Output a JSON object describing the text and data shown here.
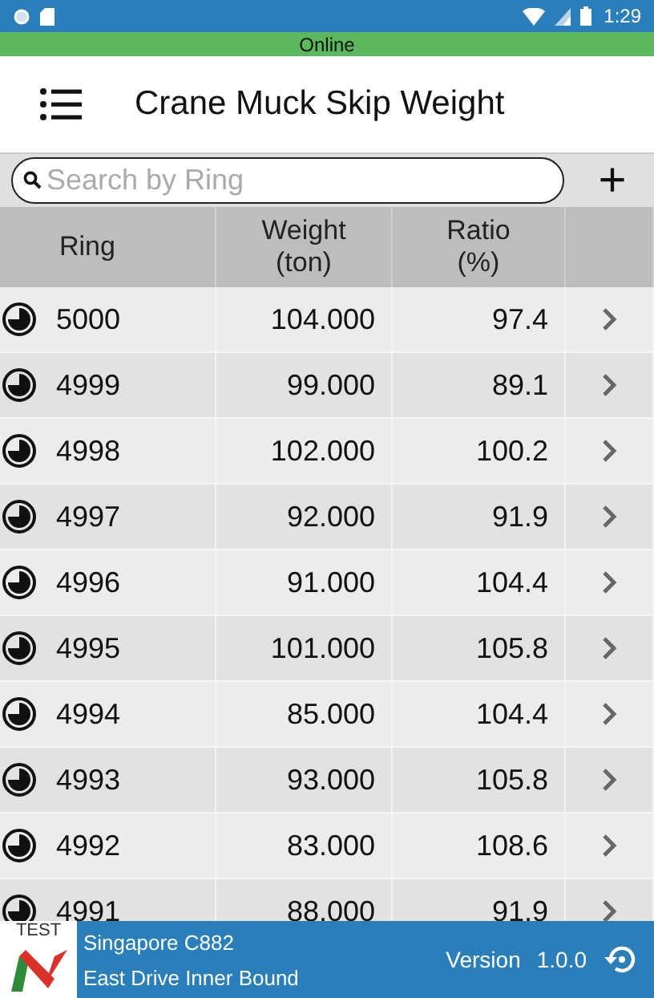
{
  "status_bar": {
    "time": "1:29"
  },
  "connection": {
    "label": "Online"
  },
  "header": {
    "title": "Crane Muck Skip Weight"
  },
  "search": {
    "placeholder": "Search by Ring",
    "add_label": "+"
  },
  "table": {
    "columns": [
      {
        "label": "Ring"
      },
      {
        "label": "Weight\n(ton)"
      },
      {
        "label": "Ratio\n(%)"
      }
    ],
    "rows": [
      {
        "ring": "5000",
        "weight": "104.000",
        "ratio": "97.4"
      },
      {
        "ring": "4999",
        "weight": "99.000",
        "ratio": "89.1"
      },
      {
        "ring": "4998",
        "weight": "102.000",
        "ratio": "100.2"
      },
      {
        "ring": "4997",
        "weight": "92.000",
        "ratio": "91.9"
      },
      {
        "ring": "4996",
        "weight": "91.000",
        "ratio": "104.4"
      },
      {
        "ring": "4995",
        "weight": "101.000",
        "ratio": "105.8"
      },
      {
        "ring": "4994",
        "weight": "85.000",
        "ratio": "104.4"
      },
      {
        "ring": "4993",
        "weight": "93.000",
        "ratio": "105.8"
      },
      {
        "ring": "4992",
        "weight": "83.000",
        "ratio": "108.6"
      },
      {
        "ring": "4991",
        "weight": "88.000",
        "ratio": "91.9"
      }
    ]
  },
  "footer": {
    "logo_text": "TEST",
    "project": "Singapore C882",
    "drive": "East Drive Inner Bound",
    "version_label": "Version",
    "version": "1.0.0"
  }
}
